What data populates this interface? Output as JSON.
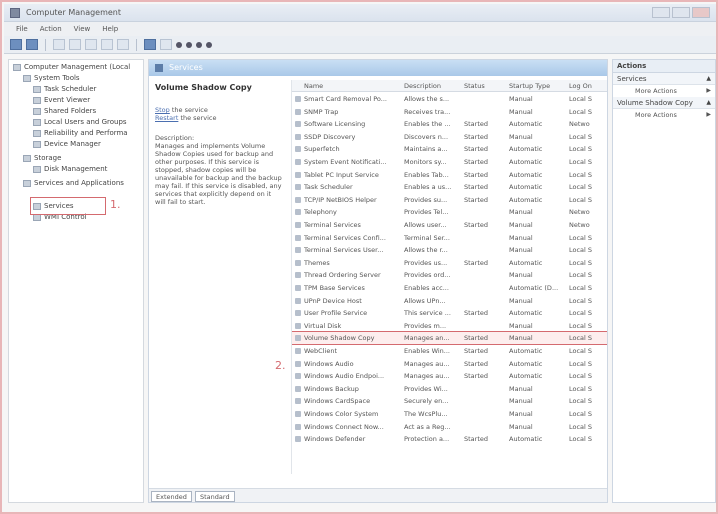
{
  "window": {
    "title": "Computer Management"
  },
  "menu": [
    "File",
    "Action",
    "View",
    "Help"
  ],
  "tree": [
    {
      "label": "Computer Management (Local",
      "indent": 0
    },
    {
      "label": "System Tools",
      "indent": 1
    },
    {
      "label": "Task Scheduler",
      "indent": 2
    },
    {
      "label": "Event Viewer",
      "indent": 2
    },
    {
      "label": "Shared Folders",
      "indent": 2
    },
    {
      "label": "Local Users and Groups",
      "indent": 2
    },
    {
      "label": "Reliability and Performa",
      "indent": 2
    },
    {
      "label": "Device Manager",
      "indent": 2
    },
    {
      "label": "Storage",
      "indent": 1
    },
    {
      "label": "Disk Management",
      "indent": 2
    },
    {
      "label": "Services and Applications",
      "indent": 1
    },
    {
      "label": "Services",
      "indent": 2
    },
    {
      "label": "WMI Control",
      "indent": 2
    }
  ],
  "markers": {
    "one": "1.",
    "two": "2."
  },
  "center": {
    "header_title": "Services",
    "desc_title": "Volume Shadow Copy",
    "stop_link": "Stop",
    "stop_rest": " the service",
    "restart_link": "Restart",
    "restart_rest": " the service",
    "desc_label": "Description:",
    "desc_text": "Manages and implements Volume Shadow Copies used for backup and other purposes. If this service is stopped, shadow copies will be unavailable for backup and the backup may fail. If this service is disabled, any services that explicitly depend on it will fail to start."
  },
  "list": {
    "columns": [
      "Name",
      "Description",
      "Status",
      "Startup Type",
      "Log On"
    ],
    "rows": [
      [
        "Smart Card Removal Po...",
        "Allows the s...",
        "",
        "Manual",
        "Local S"
      ],
      [
        "SNMP Trap",
        "Receives tra...",
        "",
        "Manual",
        "Local S"
      ],
      [
        "Software Licensing",
        "Enables the ...",
        "Started",
        "Automatic",
        "Netwo"
      ],
      [
        "SSDP Discovery",
        "Discovers n...",
        "Started",
        "Manual",
        "Local S"
      ],
      [
        "Superfetch",
        "Maintains a...",
        "Started",
        "Automatic",
        "Local S"
      ],
      [
        "System Event Notificati...",
        "Monitors sy...",
        "Started",
        "Automatic",
        "Local S"
      ],
      [
        "Tablet PC Input Service",
        "Enables Tab...",
        "Started",
        "Automatic",
        "Local S"
      ],
      [
        "Task Scheduler",
        "Enables a us...",
        "Started",
        "Automatic",
        "Local S"
      ],
      [
        "TCP/IP NetBIOS Helper",
        "Provides su...",
        "Started",
        "Automatic",
        "Local S"
      ],
      [
        "Telephony",
        "Provides Tel...",
        "",
        "Manual",
        "Netwo"
      ],
      [
        "Terminal Services",
        "Allows user...",
        "Started",
        "Manual",
        "Netwo"
      ],
      [
        "Terminal Services Confi...",
        "Terminal Ser...",
        "",
        "Manual",
        "Local S"
      ],
      [
        "Terminal Services User...",
        "Allows the r...",
        "",
        "Manual",
        "Local S"
      ],
      [
        "Themes",
        "Provides us...",
        "Started",
        "Automatic",
        "Local S"
      ],
      [
        "Thread Ordering Server",
        "Provides ord...",
        "",
        "Manual",
        "Local S"
      ],
      [
        "TPM Base Services",
        "Enables acc...",
        "",
        "Automatic (D...",
        "Local S"
      ],
      [
        "UPnP Device Host",
        "Allows UPn...",
        "",
        "Manual",
        "Local S"
      ],
      [
        "User Profile Service",
        "This service ...",
        "Started",
        "Automatic",
        "Local S"
      ],
      [
        "Virtual Disk",
        "Provides m...",
        "",
        "Manual",
        "Local S"
      ],
      [
        "Volume Shadow Copy",
        "Manages an...",
        "Started",
        "Manual",
        "Local S"
      ],
      [
        "WebClient",
        "Enables Win...",
        "Started",
        "Automatic",
        "Local S"
      ],
      [
        "Windows Audio",
        "Manages au...",
        "Started",
        "Automatic",
        "Local S"
      ],
      [
        "Windows Audio Endpoi...",
        "Manages au...",
        "Started",
        "Automatic",
        "Local S"
      ],
      [
        "Windows Backup",
        "Provides Wi...",
        "",
        "Manual",
        "Local S"
      ],
      [
        "Windows CardSpace",
        "Securely en...",
        "",
        "Manual",
        "Local S"
      ],
      [
        "Windows Color System",
        "The WcsPlu...",
        "",
        "Manual",
        "Local S"
      ],
      [
        "Windows Connect Now...",
        "Act as a Reg...",
        "",
        "Manual",
        "Local S"
      ],
      [
        "Windows Defender",
        "Protection a...",
        "Started",
        "Automatic",
        "Local S"
      ]
    ],
    "highlight_index": 19
  },
  "tabs": [
    "Extended",
    "Standard"
  ],
  "actions": {
    "title": "Actions",
    "sections": [
      {
        "label": "Services",
        "items": [
          "More Actions"
        ]
      },
      {
        "label": "Volume Shadow Copy",
        "items": [
          "More Actions"
        ]
      }
    ]
  }
}
